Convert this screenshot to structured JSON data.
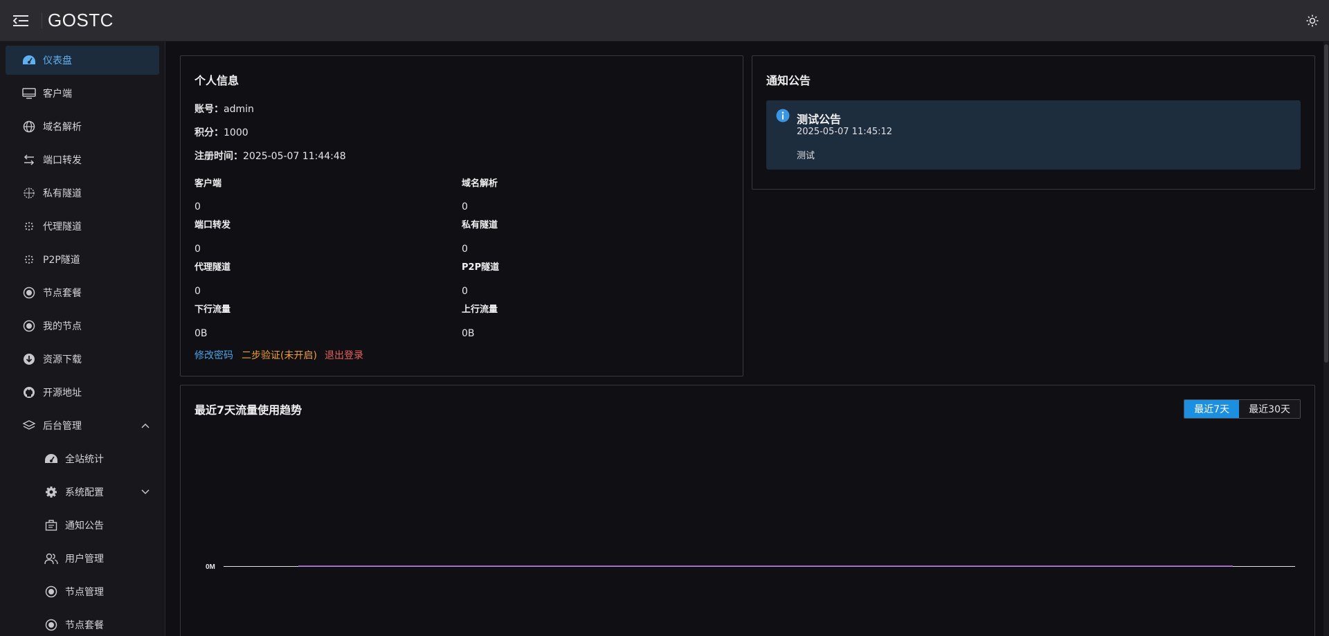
{
  "header": {
    "brand": "GOSTC",
    "menu_icon": "menu-fold-icon",
    "theme_icon": "sun-icon"
  },
  "sidebar": {
    "items": [
      {
        "label": "仪表盘",
        "icon": "dashboard-icon",
        "active": true
      },
      {
        "label": "客户端",
        "icon": "monitor-icon"
      },
      {
        "label": "域名解析",
        "icon": "globe-icon"
      },
      {
        "label": "端口转发",
        "icon": "swap-icon"
      },
      {
        "label": "私有隧道",
        "icon": "globe-dotted-icon"
      },
      {
        "label": "代理隧道",
        "icon": "proxy-icon"
      },
      {
        "label": "P2P隧道",
        "icon": "p2p-icon"
      },
      {
        "label": "节点套餐",
        "icon": "radio-icon"
      },
      {
        "label": "我的节点",
        "icon": "radio-icon"
      },
      {
        "label": "资源下载",
        "icon": "download-icon"
      },
      {
        "label": "开源地址",
        "icon": "github-icon"
      },
      {
        "label": "后台管理",
        "icon": "layers-icon",
        "expanded": true
      },
      {
        "label": "全站统计",
        "icon": "dashboard-icon",
        "sub": true
      },
      {
        "label": "系统配置",
        "icon": "gear-icon",
        "sub": true,
        "collapsed": true
      },
      {
        "label": "通知公告",
        "icon": "notice-icon",
        "sub": true
      },
      {
        "label": "用户管理",
        "icon": "users-icon",
        "sub": true
      },
      {
        "label": "节点管理",
        "icon": "radio-icon",
        "sub": true
      },
      {
        "label": "节点套餐",
        "icon": "radio-icon",
        "sub": true
      }
    ]
  },
  "profile": {
    "title": "个人信息",
    "account_label": "账号：",
    "account_value": "admin",
    "points_label": "积分：",
    "points_value": "1000",
    "registered_label": "注册时间：",
    "registered_value": "2025-05-07 11:44:48",
    "stats": [
      {
        "label": "客户端",
        "value": "0"
      },
      {
        "label": "域名解析",
        "value": "0"
      },
      {
        "label": "端口转发",
        "value": "0"
      },
      {
        "label": "私有隧道",
        "value": "0"
      },
      {
        "label": "代理隧道",
        "value": "0"
      },
      {
        "label": "P2P隧道",
        "value": "0"
      },
      {
        "label": "下行流量",
        "value": "0B"
      },
      {
        "label": "上行流量",
        "value": "0B"
      }
    ],
    "actions": {
      "change_password": "修改密码",
      "two_factor": "二步验证(未开启)",
      "logout": "退出登录"
    }
  },
  "notice": {
    "title": "通知公告",
    "item_title": "测试公告",
    "item_time": "2025-05-07 11:45:12",
    "item_body": "测试"
  },
  "traffic": {
    "title": "最近7天流量使用趋势",
    "tabs": [
      "最近7天",
      "最近30天"
    ],
    "active_tab": 0
  },
  "colors": {
    "accent": "#1d8fe0",
    "link_blue": "#4aa3e8",
    "link_orange": "#f0a030",
    "link_red": "#e8605a",
    "series": "#b06ae0"
  },
  "chart_data": {
    "type": "line",
    "title": "最近7天流量使用趋势",
    "y_tick_labels": [
      "0M"
    ],
    "series": [
      {
        "values": [
          0,
          0,
          0,
          0,
          0,
          0,
          0
        ]
      }
    ],
    "ylim": [
      0,
      0
    ],
    "grid": false
  }
}
